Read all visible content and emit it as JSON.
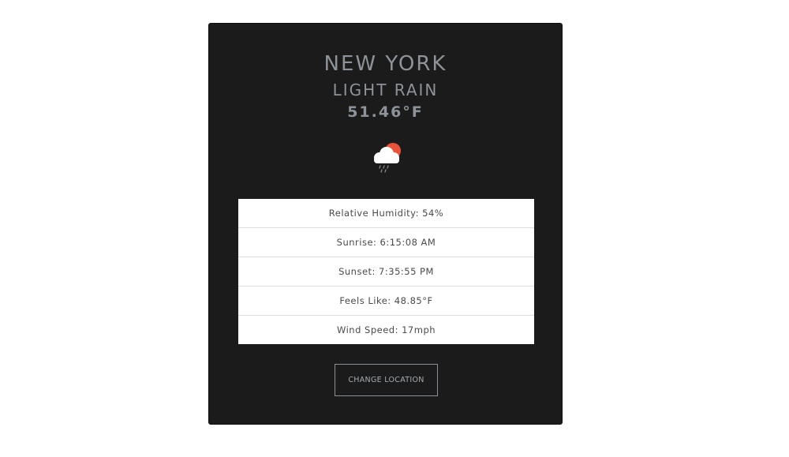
{
  "weather": {
    "city": "NEW YORK",
    "condition": "LIGHT RAIN",
    "temperature": "51.46°F",
    "icon": "cloud-rain-sun-icon"
  },
  "details": [
    {
      "label": "Relative Humidity: 54%"
    },
    {
      "label": "Sunrise: 6:15:08 AM"
    },
    {
      "label": "Sunset: 7:35:55 PM"
    },
    {
      "label": "Feels Like: 48.85°F"
    },
    {
      "label": "Wind Speed: 17mph"
    }
  ],
  "actions": {
    "change_location_label": "CHANGE LOCATION"
  },
  "colors": {
    "card_bg": "#1b1b1b",
    "heading": "#8d9399",
    "sun": "#e9533a",
    "cloud": "#ffffff"
  }
}
